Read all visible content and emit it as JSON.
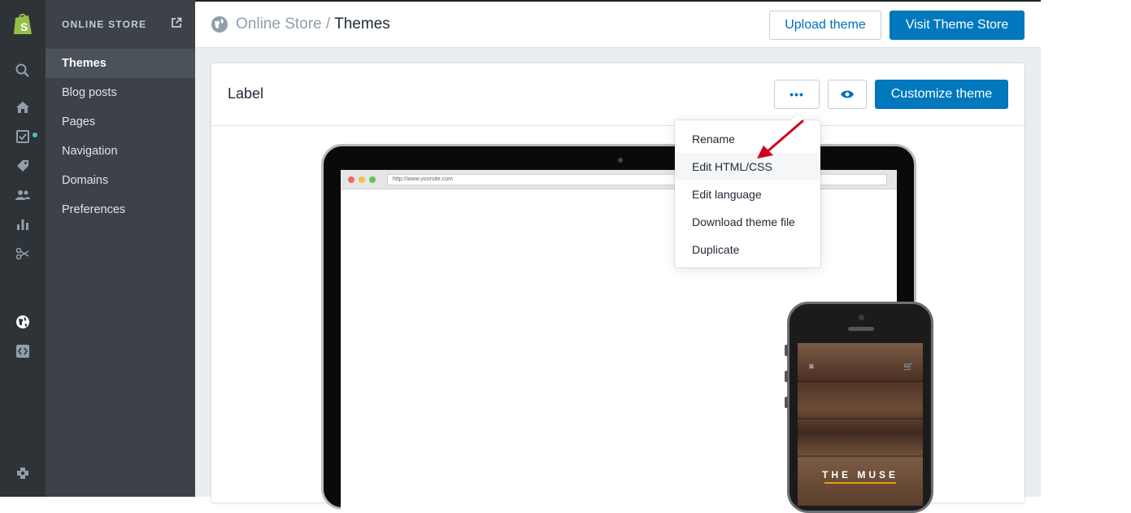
{
  "sidebar": {
    "heading": "ONLINE STORE",
    "items": [
      {
        "label": "Themes",
        "active": true
      },
      {
        "label": "Blog posts",
        "active": false
      },
      {
        "label": "Pages",
        "active": false
      },
      {
        "label": "Navigation",
        "active": false
      },
      {
        "label": "Domains",
        "active": false
      },
      {
        "label": "Preferences",
        "active": false
      }
    ]
  },
  "rail": {
    "icons": [
      "shopify-logo",
      "search-icon",
      "home-icon",
      "orders-icon",
      "products-icon",
      "customers-icon",
      "analytics-icon",
      "discounts-icon",
      "online-store-icon",
      "apps-icon",
      "settings-icon"
    ]
  },
  "header": {
    "breadcrumb_parent": "Online Store",
    "breadcrumb_separator": " / ",
    "breadcrumb_current": "Themes",
    "upload_label": "Upload theme",
    "store_label": "Visit Theme Store"
  },
  "card": {
    "title": "Label",
    "customize_label": "Customize theme",
    "more_label": "•••"
  },
  "dropdown": {
    "items": [
      "Rename",
      "Edit HTML/CSS",
      "Edit language",
      "Download theme file",
      "Duplicate"
    ]
  },
  "preview": {
    "url": "http://www.yoursite.com",
    "phone_brand": "THE MUSE",
    "menu_glyph": "≡",
    "cart_glyph": "🛒"
  },
  "colors": {
    "primary": "#0078bd",
    "rail": "#2e3338",
    "subnav": "#3c4248",
    "arrow": "#d0021b"
  }
}
